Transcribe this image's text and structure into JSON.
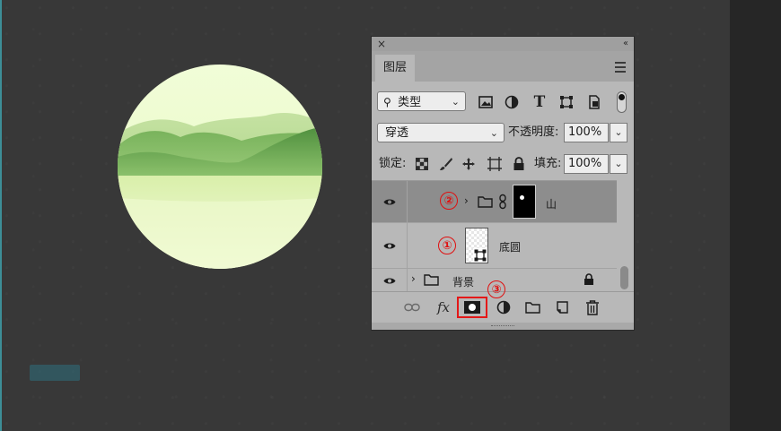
{
  "panel": {
    "tab_label": "图层",
    "filter": {
      "selected": "类型"
    },
    "blend_mode": {
      "selected": "穿透"
    },
    "opacity": {
      "label": "不透明度:",
      "value": "100%"
    },
    "lock": {
      "label": "锁定:"
    },
    "fill": {
      "label": "填充:",
      "value": "100%"
    }
  },
  "layers": [
    {
      "name": "山",
      "type": "group",
      "selected": true,
      "visible": true,
      "has_mask": true,
      "marker": "②"
    },
    {
      "name": "底圆",
      "type": "shape",
      "selected": false,
      "visible": true,
      "marker": "①"
    },
    {
      "name": "背景",
      "type": "group",
      "selected": false,
      "visible": true,
      "locked": true
    }
  ],
  "footer": {
    "fx_label": "fx",
    "highlighted": "add-mask-button",
    "marker": "③"
  },
  "colors": {
    "canvas_bg": "#383838",
    "panel_bg": "#b8b8b8",
    "selected_row": "#8d8d8d",
    "annotation_red": "#e01010",
    "accent_edge": "#3d8e97"
  }
}
